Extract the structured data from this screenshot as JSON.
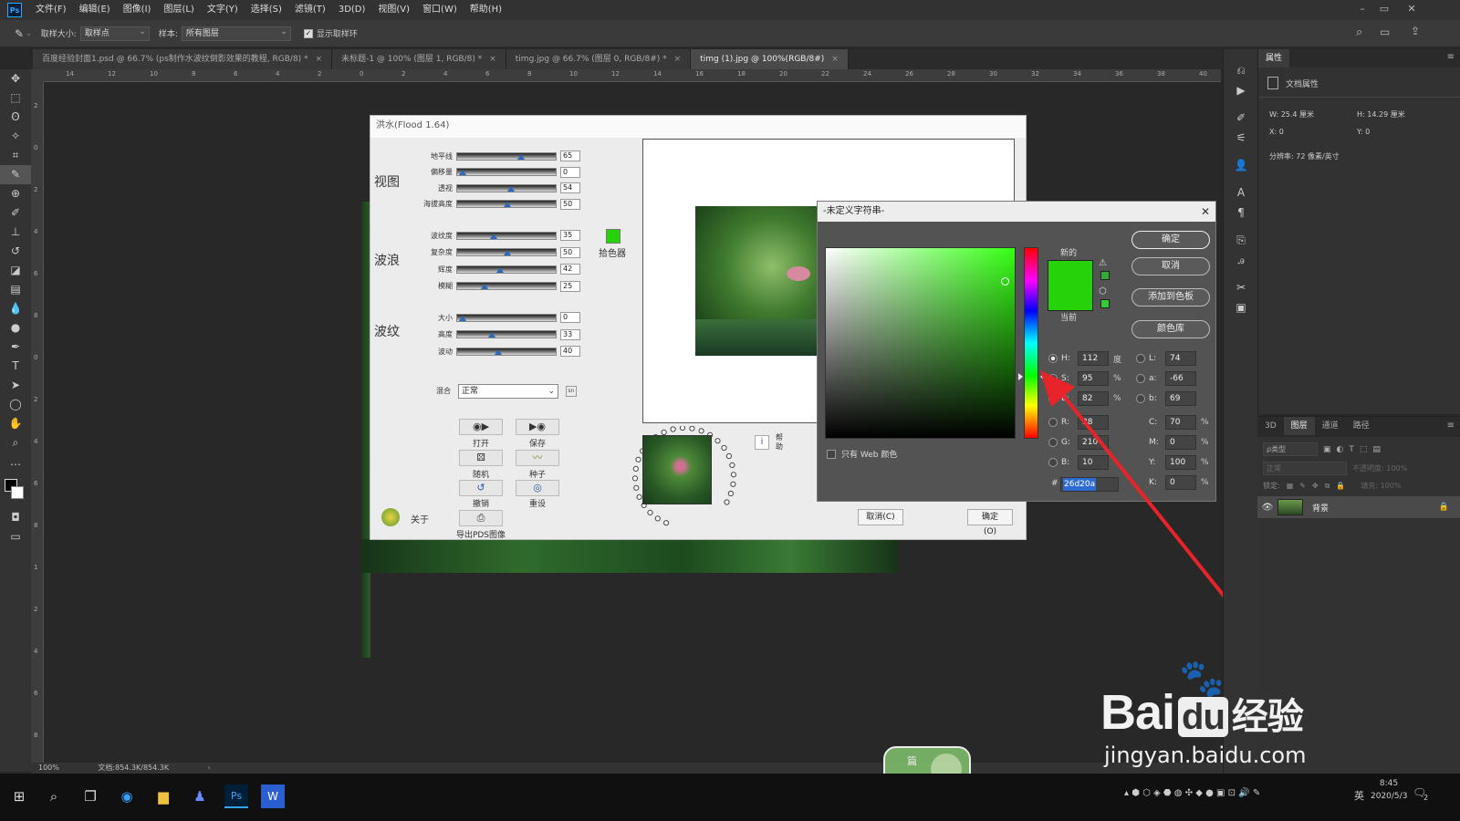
{
  "menubar": {
    "logo": "Ps",
    "items": [
      "文件(F)",
      "编辑(E)",
      "图像(I)",
      "图层(L)",
      "文字(Y)",
      "选择(S)",
      "滤镜(T)",
      "3D(D)",
      "视图(V)",
      "窗口(W)",
      "帮助(H)"
    ],
    "window_controls": [
      "–",
      "▭",
      "✕"
    ]
  },
  "options": {
    "sample_size_label": "取样大小:",
    "sample_size_value": "取样点",
    "sample_label": "样本:",
    "sample_value": "所有图层",
    "show_ring_label": "显示取样环"
  },
  "tabs": [
    {
      "label": "百度经验封面1.psd @ 66.7% (ps制作水波纹倒影效果的教程, RGB/8) *",
      "close": "×"
    },
    {
      "label": "未标题-1 @ 100% (图层 1, RGB/8) *",
      "close": "×"
    },
    {
      "label": "timg.jpg @ 66.7% (图层 0, RGB/8#) *",
      "close": "×"
    },
    {
      "label": "timg (1).jpg @ 100%(RGB/8#)",
      "close": "×"
    }
  ],
  "ruler_h": [
    "14",
    "12",
    "10",
    "8",
    "6",
    "4",
    "2",
    "0",
    "2",
    "4",
    "6",
    "8",
    "10",
    "12",
    "14",
    "16",
    "18",
    "20",
    "22",
    "24",
    "26",
    "28",
    "30",
    "32",
    "34",
    "36",
    "38",
    "40"
  ],
  "ruler_v": [
    "2",
    "0",
    "2",
    "4",
    "6",
    "8",
    "0",
    "2",
    "4",
    "6",
    "8",
    "1",
    "2",
    "4",
    "6",
    "8"
  ],
  "status": {
    "zoom": "100%",
    "doc": "文档:854.3K/854.3K"
  },
  "flood": {
    "title": "洪水(Flood 1.64)",
    "sections": {
      "view": "视图",
      "waves": "波浪",
      "ripples": "波纹"
    },
    "sliders_view": [
      {
        "label": "地平线",
        "value": "65",
        "pos": 65
      },
      {
        "label": "偏移量",
        "value": "0",
        "pos": 2
      },
      {
        "label": "透视",
        "value": "54",
        "pos": 54
      },
      {
        "label": "海拔高度",
        "value": "50",
        "pos": 50
      }
    ],
    "sliders_waves": [
      {
        "label": "波纹度",
        "value": "35",
        "pos": 35
      },
      {
        "label": "复杂度",
        "value": "50",
        "pos": 50
      },
      {
        "label": "辉度",
        "value": "42",
        "pos": 42
      },
      {
        "label": "模糊",
        "value": "25",
        "pos": 25
      }
    ],
    "sliders_ripples": [
      {
        "label": "大小",
        "value": "0",
        "pos": 2
      },
      {
        "label": "高度",
        "value": "33",
        "pos": 33
      },
      {
        "label": "波动",
        "value": "40",
        "pos": 40
      }
    ],
    "picker_label": "拾色器",
    "blend_label": "混合",
    "blend_value": "正常",
    "blend_extra": "sn",
    "buttons": {
      "open": "打开",
      "save": "保存",
      "random": "随机",
      "seed": "种子",
      "undo": "撤销",
      "reset": "重设",
      "export": "导出PDS图像"
    },
    "about": "关于",
    "help": "帮助",
    "cancel": "取消(C)",
    "ok": "确定(O)"
  },
  "picker": {
    "title": "-未定义字符串-",
    "new_label": "新的",
    "current_label": "当前",
    "ok": "确定",
    "cancel": "取消",
    "add_swatch": "添加到色板",
    "library": "颜色库",
    "web_only": "只有 Web 颜色",
    "hsb": [
      {
        "label": "H:",
        "value": "112",
        "unit": "度"
      },
      {
        "label": "S:",
        "value": "95",
        "unit": "%"
      },
      {
        "label": "B:",
        "value": "82",
        "unit": "%"
      }
    ],
    "rgb": [
      {
        "label": "R:",
        "value": "38"
      },
      {
        "label": "G:",
        "value": "210"
      },
      {
        "label": "B:",
        "value": "10"
      }
    ],
    "lab": [
      {
        "label": "L:",
        "value": "74"
      },
      {
        "label": "a:",
        "value": "-66"
      },
      {
        "label": "b:",
        "value": "69"
      }
    ],
    "cmyk": [
      {
        "label": "C:",
        "value": "70",
        "unit": "%"
      },
      {
        "label": "M:",
        "value": "0",
        "unit": "%"
      },
      {
        "label": "Y:",
        "value": "100",
        "unit": "%"
      },
      {
        "label": "K:",
        "value": "0",
        "unit": "%"
      }
    ],
    "hash": "#",
    "hex": "26d20a"
  },
  "properties": {
    "tab": "属性",
    "doc_props": "文档属性",
    "w_label": "W:",
    "w": "25.4 厘米",
    "h_label": "H:",
    "h": "14.29 厘米",
    "x_label": "X:",
    "x": "0",
    "y_label": "Y:",
    "y": "0",
    "resolution": "分辨率: 72 像素/英寸"
  },
  "layers": {
    "tabs": [
      "3D",
      "图层",
      "通道",
      "路径"
    ],
    "filter": "ρ类型",
    "mode": "正常",
    "opacity": "不透明度: 100%",
    "lock": "锁定:",
    "fill": "填充: 100%",
    "layer_name": "背景"
  },
  "taskbar": {
    "time": "8:45",
    "date": "2020/5/3",
    "lang": "英",
    "notif": "2"
  },
  "watermark": {
    "brand": "Bai",
    "du": "du",
    "jingyan": "经验",
    "url": "jingyan.baidu.com",
    "badge": "篇"
  },
  "colors": {
    "new": "#26d20a",
    "current": "#26d20a",
    "accent": "#31a8ff",
    "arrow": "#e8242a",
    "hue_base": "#35ff14"
  }
}
